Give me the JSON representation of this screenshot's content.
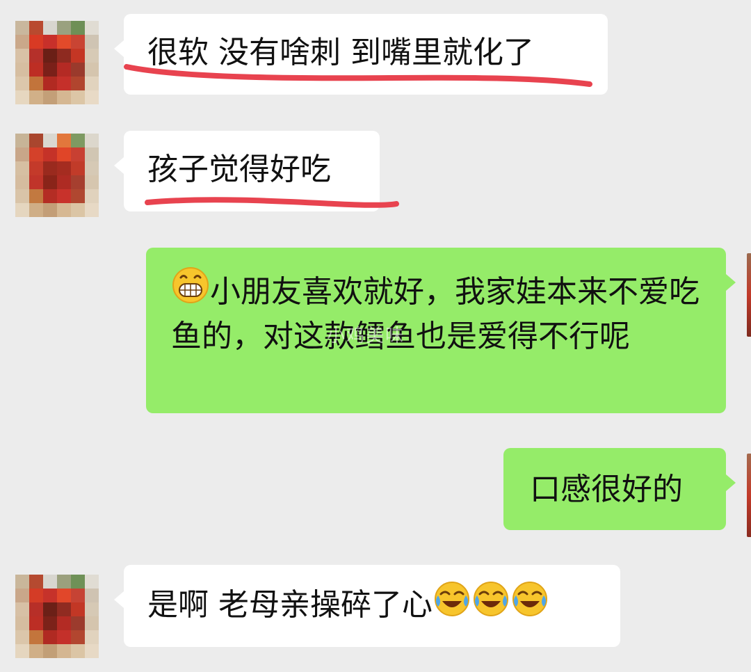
{
  "messages": [
    {
      "side": "in",
      "text": "很软 没有啥刺 到嘴里就化了",
      "underlined": true
    },
    {
      "side": "in",
      "text": "孩子觉得好吃",
      "underlined": true
    },
    {
      "side": "out",
      "emoji": "grinning-face-emoji",
      "text": "小朋友喜欢就好，我家娃本来不爱吃鱼的，对这款鳕鱼也是爱得不行呢"
    },
    {
      "side": "out",
      "text": "口感很好的"
    },
    {
      "side": "in",
      "text": "是啊 老母亲操碎了心",
      "emojis": [
        "face-with-tears-of-joy-emoji",
        "face-with-tears-of-joy-emoji",
        "face-with-tears-of-joy-emoji"
      ]
    }
  ],
  "watermark": "小鸡美味",
  "colors": {
    "background": "#ececec",
    "incoming_bubble": "#ffffff",
    "outgoing_bubble": "#95ec69",
    "underline": "#e8434f"
  },
  "avatar": {
    "style": "pixelated",
    "description_icon": "avatar-icon"
  }
}
